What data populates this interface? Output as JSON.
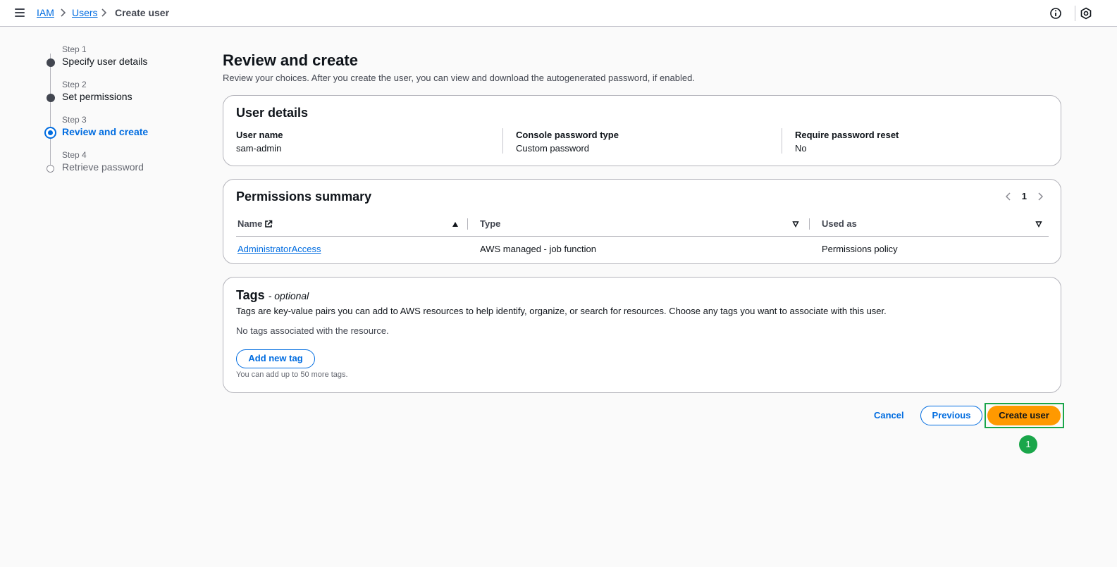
{
  "breadcrumb": {
    "items": [
      "IAM",
      "Users"
    ],
    "current": "Create user"
  },
  "icons": {
    "menu": "hamburger-menu-icon",
    "info": "info-icon",
    "settings": "settings-icon"
  },
  "wizard": {
    "steps": [
      {
        "num": "Step 1",
        "title": "Specify user details",
        "state": "done"
      },
      {
        "num": "Step 2",
        "title": "Set permissions",
        "state": "done"
      },
      {
        "num": "Step 3",
        "title": "Review and create",
        "state": "active"
      },
      {
        "num": "Step 4",
        "title": "Retrieve password",
        "state": "pending"
      }
    ]
  },
  "page": {
    "title": "Review and create",
    "description": "Review your choices. After you create the user, you can view and download the autogenerated password, if enabled."
  },
  "user_details": {
    "title": "User details",
    "fields": [
      {
        "label": "User name",
        "value": "sam-admin"
      },
      {
        "label": "Console password type",
        "value": "Custom password"
      },
      {
        "label": "Require password reset",
        "value": "No"
      }
    ]
  },
  "permissions": {
    "title": "Permissions summary",
    "page": "1",
    "columns": [
      "Name",
      "Type",
      "Used as"
    ],
    "rows": [
      {
        "name": "AdministratorAccess",
        "type": "AWS managed - job function",
        "used_as": "Permissions policy"
      }
    ]
  },
  "tags": {
    "title": "Tags",
    "optional": "- optional",
    "description": "Tags are key-value pairs you can add to AWS resources to help identify, organize, or search for resources. Choose any tags you want to associate with this user.",
    "empty": "No tags associated with the resource.",
    "add_button": "Add new tag",
    "hint": "You can add up to 50 more tags."
  },
  "actions": {
    "cancel": "Cancel",
    "previous": "Previous",
    "create": "Create user"
  },
  "annotation": {
    "badge": "1"
  },
  "colors": {
    "accent": "#006ce0",
    "primary_button": "#ff9900",
    "highlight": "#1aa64a"
  }
}
